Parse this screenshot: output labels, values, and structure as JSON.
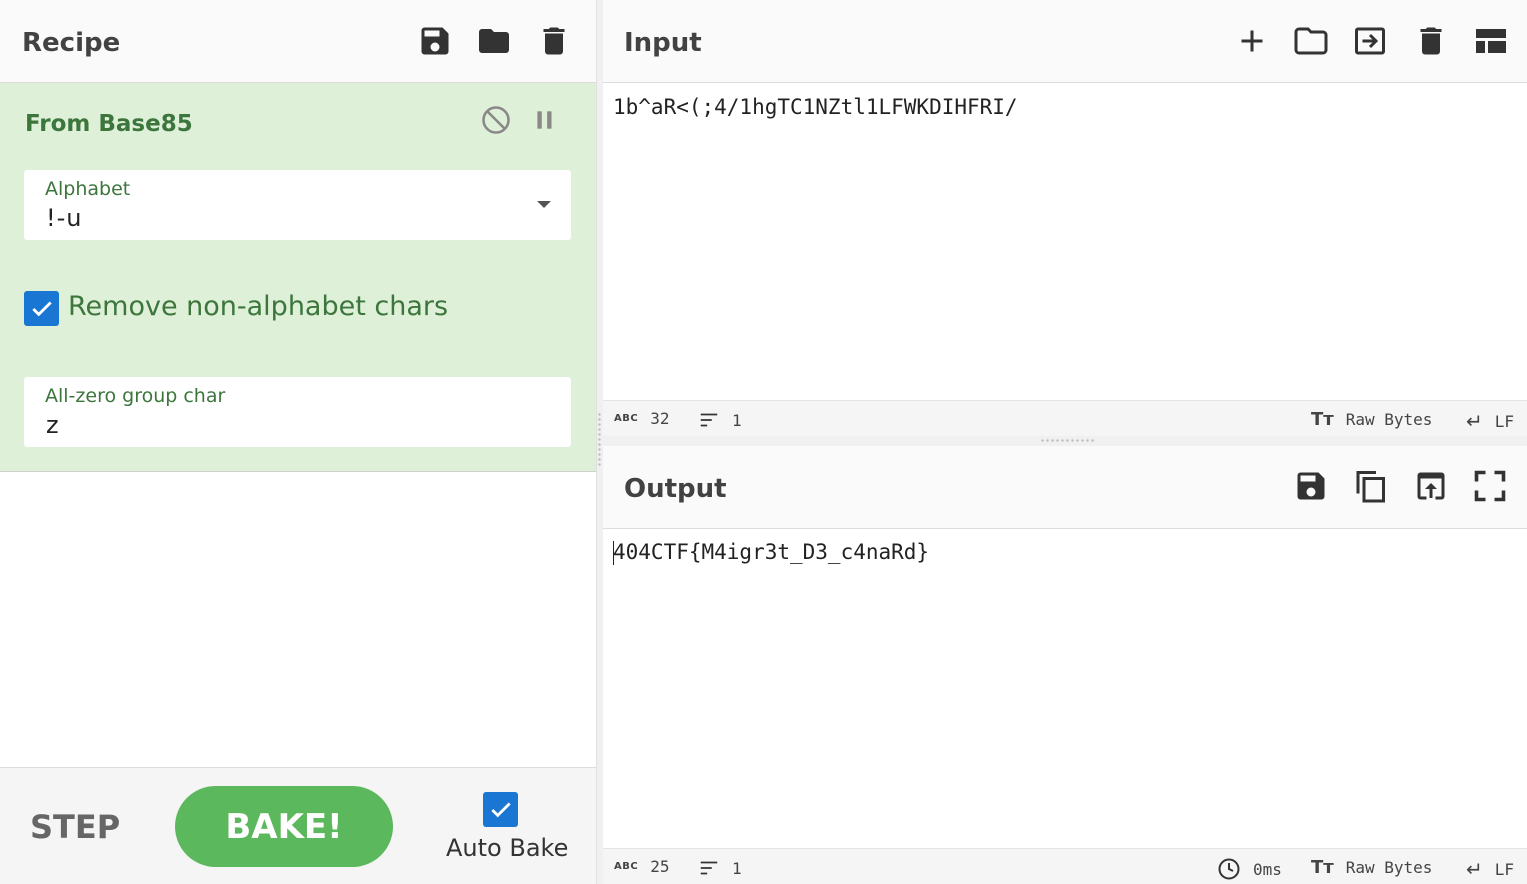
{
  "recipe": {
    "title": "Recipe",
    "operation": {
      "name": "From Base85",
      "alphabet_label": "Alphabet",
      "alphabet_value": "!-u",
      "remove_nonalpha_label": "Remove non-alphabet chars",
      "remove_nonalpha_checked": true,
      "zero_char_label": "All-zero group char",
      "zero_char_value": "z"
    },
    "controls": {
      "step_label": "STEP",
      "bake_label": "BAKE!",
      "auto_bake_label": "Auto Bake",
      "auto_bake_checked": true
    }
  },
  "input": {
    "title": "Input",
    "text": "1b^aR<(;4/1hgTC1NZtl1LFWKDIHFRI/",
    "status": {
      "abc_icon": "ABC",
      "length": "32",
      "lines": "1",
      "encoding": "Raw Bytes",
      "eol": "LF"
    }
  },
  "output": {
    "title": "Output",
    "text": "404CTF{M4igr3t_D3_c4naRd}",
    "status": {
      "abc_icon": "ABC",
      "length": "25",
      "lines": "1",
      "time": "0ms",
      "encoding": "Raw Bytes",
      "eol": "LF"
    }
  },
  "colors": {
    "operation_bg": "#dff0d8",
    "operation_text": "#3c763d",
    "bake_button": "#5cb85c",
    "checkbox": "#1976d2"
  }
}
